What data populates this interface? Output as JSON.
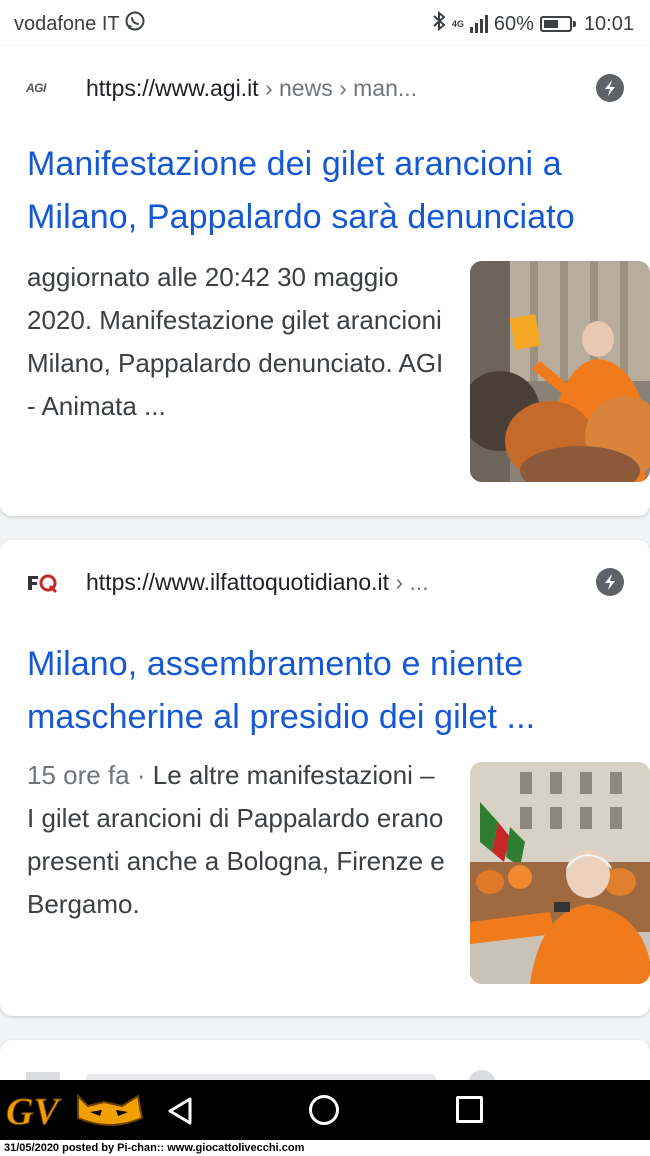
{
  "status_bar": {
    "carrier": "vodafone IT",
    "network_type": "4G",
    "battery": "60%",
    "battery_level": 0.6,
    "time": "10:01",
    "icons": [
      "whatsapp-icon",
      "bluetooth-icon",
      "signal-icon",
      "battery-icon"
    ]
  },
  "results": [
    {
      "site_logo_text": "AGI",
      "url": "https://www.agi.it",
      "breadcrumb": " › news › man...",
      "title": "Manifestazione dei gilet arancioni a Milano, Pappalardo sarà denunciato",
      "age": "",
      "snippet": "aggiornato alle 20:42 30 maggio 2020. Manifestazione gilet arancioni Milano, Pappalardo denunciato. AGI - Animata ...",
      "thumbnail": "protest-photo"
    },
    {
      "site_logo_text": "FQ",
      "url": "https://www.ilfattoquotidiano.it",
      "breadcrumb": " › ...",
      "title": "Milano, assembramento e niente mascherine al presidio dei gilet ...",
      "age": "15 ore fa · ",
      "snippet": "Le altre manifestazioni – I gilet arancioni di Pappalardo erano presenti anche a Bologna, Firenze e Bergamo.",
      "thumbnail": "protest-photo"
    }
  ],
  "partial_result": {
    "hint": "partially hidden result"
  },
  "nav_bar": {
    "logo_text": "GV",
    "buttons": [
      "back-button",
      "home-button",
      "recents-button"
    ]
  },
  "footer": {
    "caption": "31/05/2020 posted by Pi-chan:: www.giocattolivecchi.com"
  },
  "colors": {
    "link": "#1558d6",
    "text": "#3c4043",
    "muted": "#70757a",
    "orange": "#f07b1d"
  }
}
